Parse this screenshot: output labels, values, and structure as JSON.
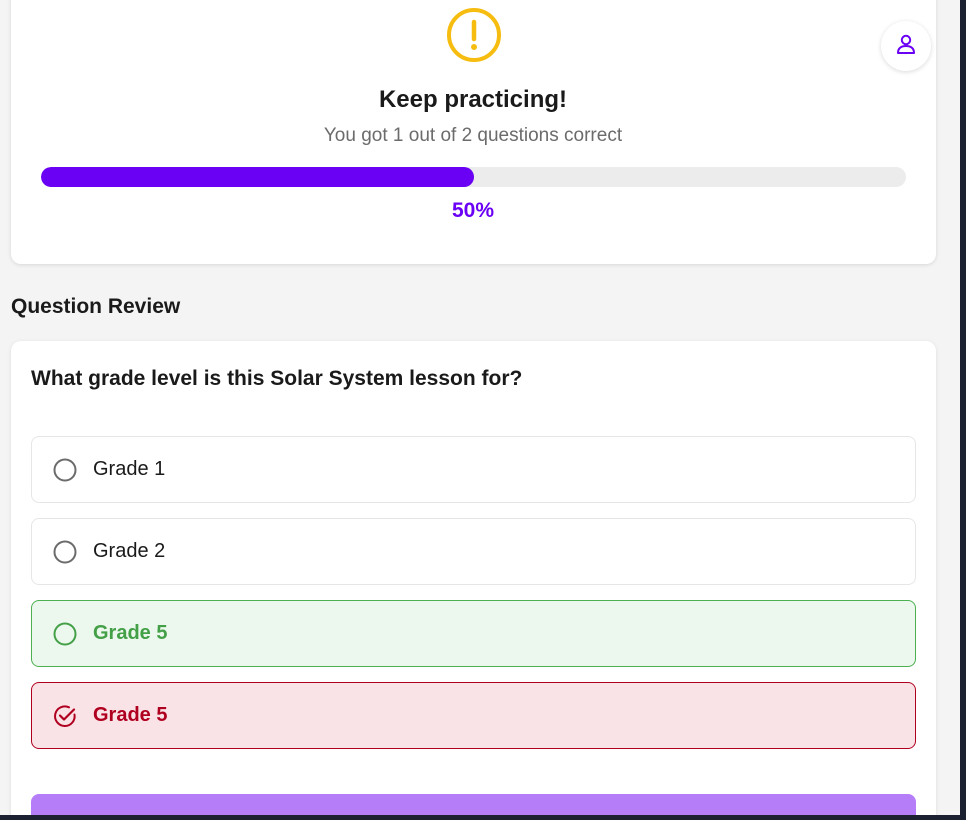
{
  "result": {
    "icon": "exclamation-circle-icon",
    "title": "Keep practicing!",
    "subtitle": "You got 1 out of 2 questions correct",
    "progress_fraction": 0.5,
    "percent_label": "50%"
  },
  "header": {
    "profile_icon": "user-icon"
  },
  "review": {
    "section_title": "Question Review",
    "question": "What grade level is this Solar System lesson for?",
    "options": [
      {
        "label": "Grade 1",
        "state": "neutral",
        "icon": "radio-empty-icon"
      },
      {
        "label": "Grade 2",
        "state": "neutral",
        "icon": "radio-empty-icon"
      },
      {
        "label": "Grade 5",
        "state": "correct",
        "icon": "radio-empty-icon"
      },
      {
        "label": "Grade 5",
        "state": "selected-wrong",
        "icon": "check-circle-icon"
      }
    ]
  },
  "colors": {
    "accent": "#6a00f4",
    "warning": "#f6bd10",
    "correct": "#43a047",
    "wrong": "#b00020",
    "button": "#b57ef8"
  }
}
